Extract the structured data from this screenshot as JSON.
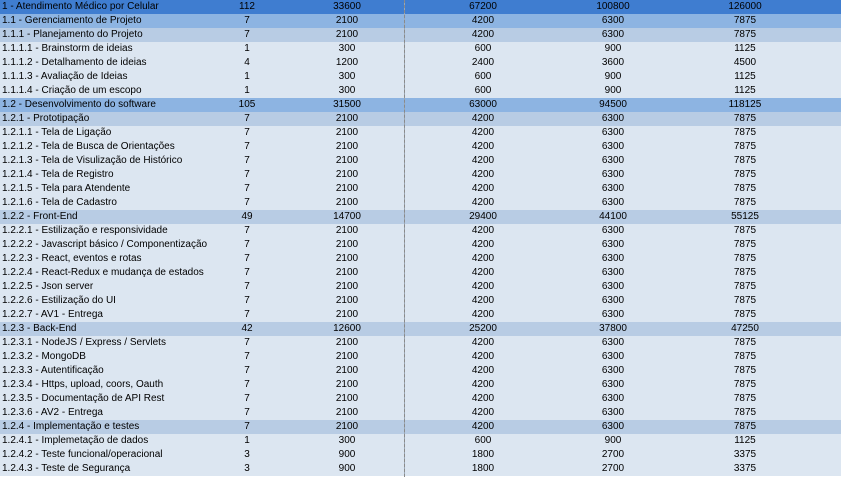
{
  "colors": {
    "level0": "#3f7dd0",
    "level1": "#8db4e2",
    "level2": "#b8cce4",
    "leaf": "#dce6f1"
  },
  "rows": [
    {
      "level": 0,
      "name": "1 - Atendimento Médico por Celular",
      "v": [
        "112",
        "33600",
        "67200",
        "100800",
        "126000"
      ]
    },
    {
      "level": 1,
      "name": "1.1 - Gerenciamento de Projeto",
      "v": [
        "7",
        "2100",
        "4200",
        "6300",
        "7875"
      ]
    },
    {
      "level": 2,
      "name": "1.1.1 - Planejamento do Projeto",
      "v": [
        "7",
        "2100",
        "4200",
        "6300",
        "7875"
      ]
    },
    {
      "level": 3,
      "name": "1.1.1.1 - Brainstorm de ideias",
      "v": [
        "1",
        "300",
        "600",
        "900",
        "1125"
      ]
    },
    {
      "level": 3,
      "name": "1.1.1.2 - Detalhamento de ideias",
      "v": [
        "4",
        "1200",
        "2400",
        "3600",
        "4500"
      ]
    },
    {
      "level": 3,
      "name": "1.1.1.3 - Avaliação de Ideias",
      "v": [
        "1",
        "300",
        "600",
        "900",
        "1125"
      ]
    },
    {
      "level": 3,
      "name": "1.1.1.4 - Criação de um escopo",
      "v": [
        "1",
        "300",
        "600",
        "900",
        "1125"
      ]
    },
    {
      "level": 1,
      "name": "1.2 - Desenvolvimento do software",
      "v": [
        "105",
        "31500",
        "63000",
        "94500",
        "118125"
      ]
    },
    {
      "level": 2,
      "name": "1.2.1 - Prototipação",
      "v": [
        "7",
        "2100",
        "4200",
        "6300",
        "7875"
      ]
    },
    {
      "level": 3,
      "name": "1.2.1.1 - Tela de Ligação",
      "v": [
        "7",
        "2100",
        "4200",
        "6300",
        "7875"
      ]
    },
    {
      "level": 3,
      "name": "1.2.1.2 - Tela de Busca de Orientações",
      "v": [
        "7",
        "2100",
        "4200",
        "6300",
        "7875"
      ]
    },
    {
      "level": 3,
      "name": "1.2.1.3 - Tela de Visulização de Histórico",
      "v": [
        "7",
        "2100",
        "4200",
        "6300",
        "7875"
      ]
    },
    {
      "level": 3,
      "name": "1.2.1.4 - Tela de Registro",
      "v": [
        "7",
        "2100",
        "4200",
        "6300",
        "7875"
      ]
    },
    {
      "level": 3,
      "name": "1.2.1.5 - Tela para Atendente",
      "v": [
        "7",
        "2100",
        "4200",
        "6300",
        "7875"
      ]
    },
    {
      "level": 3,
      "name": "1.2.1.6 - Tela de Cadastro",
      "v": [
        "7",
        "2100",
        "4200",
        "6300",
        "7875"
      ]
    },
    {
      "level": 2,
      "name": "1.2.2 - Front-End",
      "v": [
        "49",
        "14700",
        "29400",
        "44100",
        "55125"
      ]
    },
    {
      "level": 3,
      "name": "1.2.2.1 - Estilização e responsividade",
      "v": [
        "7",
        "2100",
        "4200",
        "6300",
        "7875"
      ]
    },
    {
      "level": 3,
      "name": "1.2.2.2 - Javascript básico / Componentização",
      "v": [
        "7",
        "2100",
        "4200",
        "6300",
        "7875"
      ]
    },
    {
      "level": 3,
      "name": "1.2.2.3 - React, eventos e rotas",
      "v": [
        "7",
        "2100",
        "4200",
        "6300",
        "7875"
      ]
    },
    {
      "level": 3,
      "name": "1.2.2.4 - React-Redux e mudança de estados",
      "v": [
        "7",
        "2100",
        "4200",
        "6300",
        "7875"
      ]
    },
    {
      "level": 3,
      "name": "1.2.2.5 - Json server",
      "v": [
        "7",
        "2100",
        "4200",
        "6300",
        "7875"
      ]
    },
    {
      "level": 3,
      "name": "1.2.2.6 - Estilização do UI",
      "v": [
        "7",
        "2100",
        "4200",
        "6300",
        "7875"
      ]
    },
    {
      "level": 3,
      "name": "1.2.2.7 - AV1 - Entrega",
      "v": [
        "7",
        "2100",
        "4200",
        "6300",
        "7875"
      ]
    },
    {
      "level": 2,
      "name": "1.2.3 - Back-End",
      "v": [
        "42",
        "12600",
        "25200",
        "37800",
        "47250"
      ]
    },
    {
      "level": 3,
      "name": "1.2.3.1 - NodeJS / Express / Servlets",
      "v": [
        "7",
        "2100",
        "4200",
        "6300",
        "7875"
      ]
    },
    {
      "level": 3,
      "name": "1.2.3.2 - MongoDB",
      "v": [
        "7",
        "2100",
        "4200",
        "6300",
        "7875"
      ]
    },
    {
      "level": 3,
      "name": "1.2.3.3 - Autentificação",
      "v": [
        "7",
        "2100",
        "4200",
        "6300",
        "7875"
      ]
    },
    {
      "level": 3,
      "name": "1.2.3.4 - Https, upload, coors, Oauth",
      "v": [
        "7",
        "2100",
        "4200",
        "6300",
        "7875"
      ]
    },
    {
      "level": 3,
      "name": "1.2.3.5 - Documentação de API Rest",
      "v": [
        "7",
        "2100",
        "4200",
        "6300",
        "7875"
      ]
    },
    {
      "level": 3,
      "name": "1.2.3.6 - AV2 - Entrega",
      "v": [
        "7",
        "2100",
        "4200",
        "6300",
        "7875"
      ]
    },
    {
      "level": 2,
      "name": "1.2.4 - Implementação e testes",
      "v": [
        "7",
        "2100",
        "4200",
        "6300",
        "7875"
      ]
    },
    {
      "level": 3,
      "name": "1.2.4.1 - Implemetação de dados",
      "v": [
        "1",
        "300",
        "600",
        "900",
        "1125"
      ]
    },
    {
      "level": 3,
      "name": "1.2.4.2 - Teste funcional/operacional",
      "v": [
        "3",
        "900",
        "1800",
        "2700",
        "3375"
      ]
    },
    {
      "level": 3,
      "name": "1.2.4.3 - Teste de Segurança",
      "v": [
        "3",
        "900",
        "1800",
        "2700",
        "3375"
      ]
    }
  ]
}
